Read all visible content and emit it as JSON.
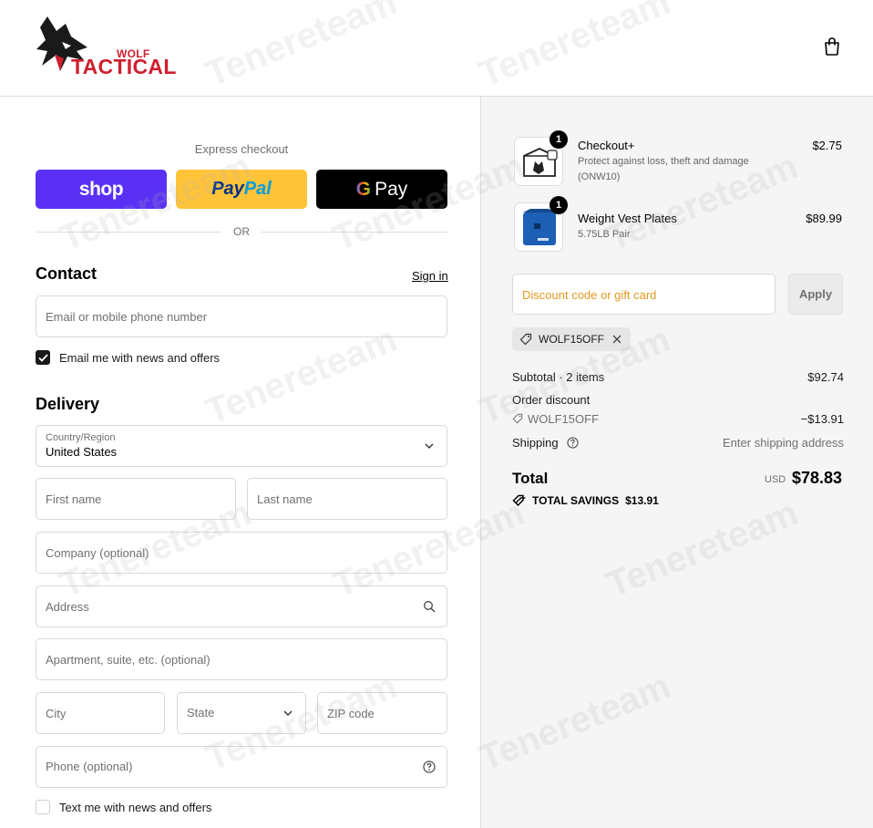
{
  "header": {
    "logo_brand_small": "WOLF",
    "logo_brand_large": "TACTICAL",
    "cart_icon": "shopping-bag-icon"
  },
  "express": {
    "label": "Express checkout",
    "shop_label": "shop",
    "paypal_part1": "Pay",
    "paypal_part2": "Pal",
    "gpay_g": "G",
    "gpay_label": "Pay",
    "or_label": "OR"
  },
  "contact": {
    "title": "Contact",
    "signin_label": "Sign in",
    "email_placeholder": "Email or mobile phone number",
    "news_checkbox_label": "Email me with news and offers",
    "news_checked": true
  },
  "delivery": {
    "title": "Delivery",
    "country_label": "Country/Region",
    "country_value": "United States",
    "first_name_placeholder": "First name",
    "last_name_placeholder": "Last name",
    "company_placeholder": "Company (optional)",
    "address_placeholder": "Address",
    "apartment_placeholder": "Apartment, suite, etc. (optional)",
    "city_placeholder": "City",
    "state_placeholder": "State",
    "zip_placeholder": "ZIP code",
    "phone_placeholder": "Phone (optional)",
    "text_checkbox_label": "Text me with news and offers",
    "text_checked": false
  },
  "order": {
    "items": [
      {
        "qty": "1",
        "name": "Checkout+",
        "sub_line1": "Protect against loss, theft and damage",
        "sub_line2": "(ONW10)",
        "price": "$2.75"
      },
      {
        "qty": "1",
        "name": "Weight Vest Plates",
        "sub_line1": "5.75LB Pair",
        "price": "$89.99"
      }
    ],
    "discount_placeholder": "Discount code or gift card",
    "apply_label": "Apply",
    "applied_code": "WOLF15OFF",
    "subtotal_label": "Subtotal · 2 items",
    "subtotal_value": "$92.74",
    "order_discount_label": "Order discount",
    "order_discount_code": "WOLF15OFF",
    "order_discount_value": "−$13.91",
    "shipping_label": "Shipping",
    "shipping_value": "Enter shipping address",
    "total_label": "Total",
    "total_currency": "USD",
    "total_value": "$78.83",
    "savings_label": "TOTAL SAVINGS",
    "savings_value": "$13.91"
  },
  "watermark": "Tenereteam",
  "colors": {
    "shop_purple": "#5a31f4",
    "paypal_yellow": "#ffc439",
    "brand_red": "#cf1f2e",
    "discount_placeholder_orange": "#e39820"
  }
}
